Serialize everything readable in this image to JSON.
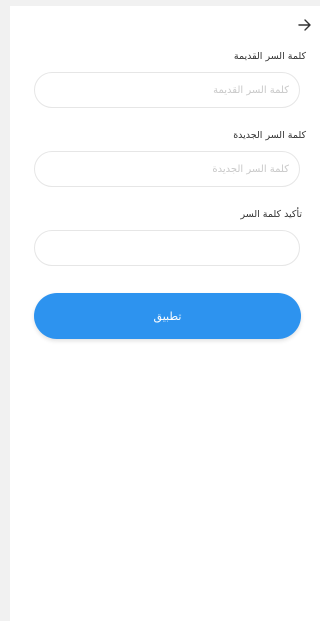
{
  "header": {
    "back_icon": "arrow-right-icon"
  },
  "form": {
    "old_password": {
      "label": "كلمة السر القديمة",
      "placeholder": "كلمة السر القديمة",
      "value": ""
    },
    "new_password": {
      "label": "كلمة السر الجديدة",
      "placeholder": "كلمة السر الجديدة",
      "value": ""
    },
    "confirm_password": {
      "label": "تأكيد كلمة السر",
      "placeholder": "",
      "value": ""
    }
  },
  "actions": {
    "apply_label": "تطبيق"
  },
  "colors": {
    "accent": "#2d93ef",
    "input_border": "#e6e6e6",
    "placeholder": "#c9c9c9"
  }
}
